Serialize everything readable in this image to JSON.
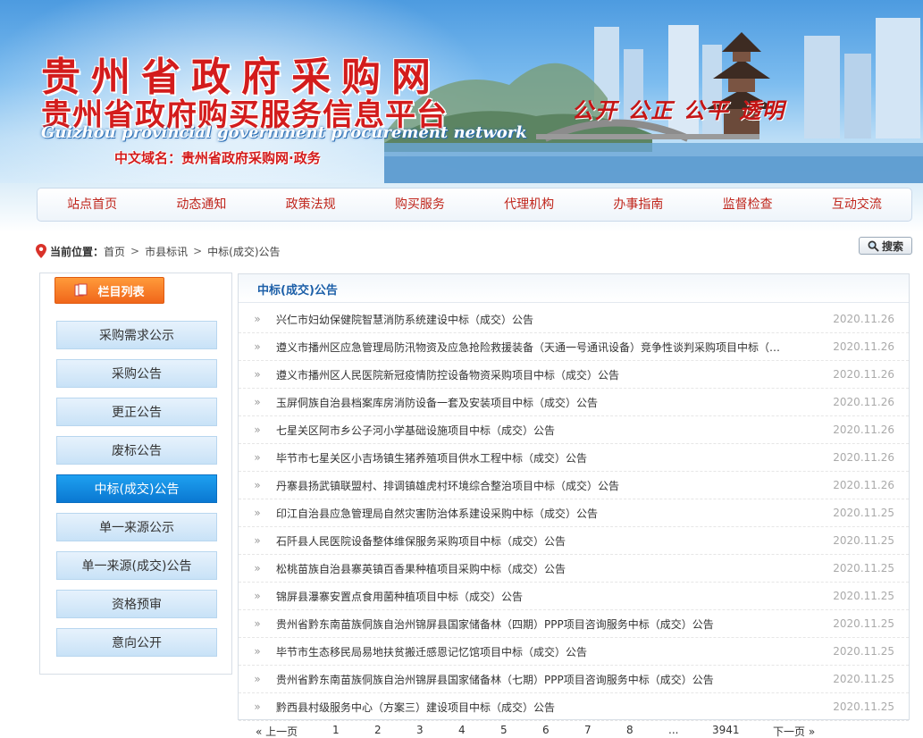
{
  "header": {
    "title": "贵州省政府采购网",
    "subtitle": "贵州省政府购买服务信息平台",
    "subtitle_en": "Guizhou provincial government procurement network",
    "domain_line": "中文域名：贵州省政府采购网·政务",
    "slogan": "公开 公正 公平 透明"
  },
  "nav": {
    "items": [
      "站点首页",
      "动态通知",
      "政策法规",
      "购买服务",
      "代理机构",
      "办事指南",
      "监督检查",
      "互动交流"
    ]
  },
  "breadcrumb": {
    "label": "当前位置：",
    "items": [
      "首页",
      "市县标讯",
      "中标(成交)公告"
    ],
    "separator": ">"
  },
  "search": {
    "label": "搜索"
  },
  "sidebar": {
    "title": "栏目列表",
    "items": [
      "采购需求公示",
      "采购公告",
      "更正公告",
      "废标公告",
      "中标(成交)公告",
      "单一来源公示",
      "单一来源(成交)公告",
      "资格预审",
      "意向公开"
    ],
    "active_index": 4
  },
  "main": {
    "title": "中标(成交)公告",
    "rows": [
      {
        "title": "兴仁市妇幼保健院智慧消防系统建设中标（成交）公告",
        "date": "2020.11.26"
      },
      {
        "title": "遵义市播州区应急管理局防汛物资及应急抢险救援装备（天通一号通讯设备）竞争性谈判采购项目中标（…",
        "date": "2020.11.26"
      },
      {
        "title": "遵义市播州区人民医院新冠疫情防控设备物资采购项目中标（成交）公告",
        "date": "2020.11.26"
      },
      {
        "title": "玉屏侗族自治县档案库房消防设备一套及安装项目中标（成交）公告",
        "date": "2020.11.26"
      },
      {
        "title": "七星关区阿市乡公子河小学基础设施项目中标（成交）公告",
        "date": "2020.11.26"
      },
      {
        "title": "毕节市七星关区小吉场镇生猪养殖项目供水工程中标（成交）公告",
        "date": "2020.11.26"
      },
      {
        "title": "丹寨县扬武镇联盟村、排调镇雄虎村环境综合整治项目中标（成交）公告",
        "date": "2020.11.26"
      },
      {
        "title": "印江自治县应急管理局自然灾害防治体系建设采购中标（成交）公告",
        "date": "2020.11.25"
      },
      {
        "title": "石阡县人民医院设备整体维保服务采购项目中标（成交）公告",
        "date": "2020.11.25"
      },
      {
        "title": "松桃苗族自治县寨英镇百香果种植项目采购中标（成交）公告",
        "date": "2020.11.25"
      },
      {
        "title": "锦屏县瀑寨安置点食用菌种植项目中标（成交）公告",
        "date": "2020.11.25"
      },
      {
        "title": "贵州省黔东南苗族侗族自治州锦屏县国家储备林（四期）PPP项目咨询服务中标（成交）公告",
        "date": "2020.11.25"
      },
      {
        "title": "毕节市生态移民局易地扶贫搬迁感恩记忆馆项目中标（成交）公告",
        "date": "2020.11.25"
      },
      {
        "title": "贵州省黔东南苗族侗族自治州锦屏县国家储备林（七期）PPP项目咨询服务中标（成交）公告",
        "date": "2020.11.25"
      },
      {
        "title": "黔西县村级服务中心（方案三）建设项目中标（成交）公告",
        "date": "2020.11.25"
      }
    ]
  },
  "pagination": {
    "prev": "« 上一页",
    "pages": [
      "1",
      "2",
      "3",
      "4",
      "5",
      "6",
      "7",
      "8"
    ],
    "ellipsis": "...",
    "last": "3941",
    "next": "下一页 »"
  },
  "colors": {
    "brand_red": "#d31c1c",
    "nav_text": "#c0261c",
    "active_blue": "#0a78d2",
    "list_title_blue": "#1c5fa8",
    "orange_head": "#f0661a"
  }
}
